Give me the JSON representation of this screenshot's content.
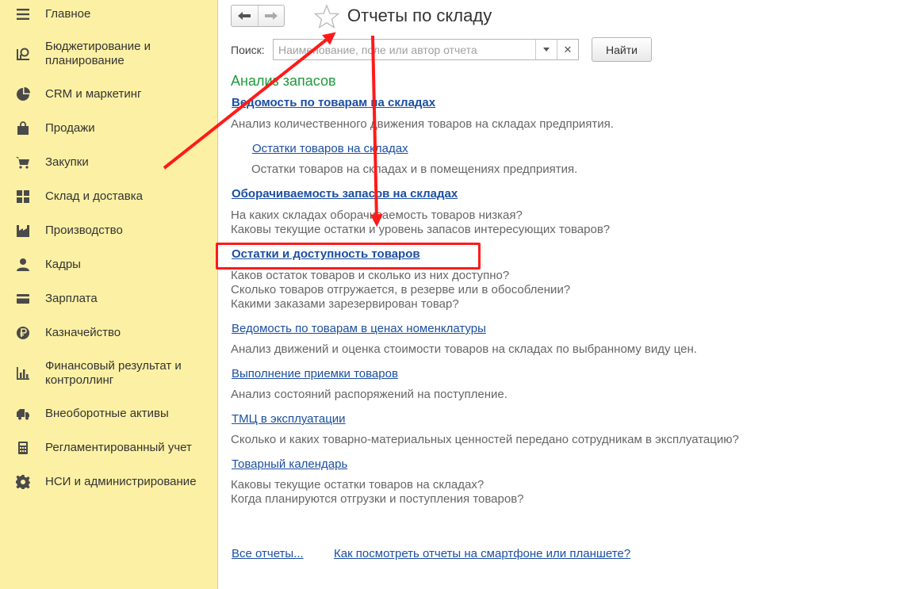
{
  "sidebar": {
    "items": [
      {
        "label": "Главное",
        "icon": "menu-icon"
      },
      {
        "label": "Бюджетирование и\nпланирование",
        "icon": "budget-chart-icon"
      },
      {
        "label": "CRM и маркетинг",
        "icon": "pie-chart-icon"
      },
      {
        "label": "Продажи",
        "icon": "shopping-bag-icon"
      },
      {
        "label": "Закупки",
        "icon": "cart-icon"
      },
      {
        "label": "Склад и доставка",
        "icon": "warehouse-grid-icon"
      },
      {
        "label": "Производство",
        "icon": "factory-icon"
      },
      {
        "label": "Кадры",
        "icon": "person-icon"
      },
      {
        "label": "Зарплата",
        "icon": "card-icon"
      },
      {
        "label": "Казначейство",
        "icon": "ruble-coin-icon"
      },
      {
        "label": "Финансовый результат и\nконтроллинг",
        "icon": "bar-chart-icon"
      },
      {
        "label": "Внеоборотные активы",
        "icon": "truck-icon"
      },
      {
        "label": "Регламентированный учет",
        "icon": "calculator-icon"
      },
      {
        "label": "НСИ и администрирование",
        "icon": "gear-icon"
      }
    ]
  },
  "header": {
    "title": "Отчеты по складу",
    "back_icon": "arrow-left-icon",
    "forward_icon": "arrow-right-icon",
    "favorite_icon": "star-icon"
  },
  "search": {
    "label": "Поиск:",
    "placeholder": "Наименование, поле или автор отчета",
    "value": "",
    "find_button": "Найти"
  },
  "section": {
    "title": "Анализ запасов",
    "reports": [
      {
        "title": "Ведомость по товарам на складах",
        "bold": true,
        "description": [
          "Анализ количественного движения товаров на складах предприятия."
        ]
      },
      {
        "title": "Остатки товаров на складах",
        "bold": false,
        "description": [
          "Остатки товаров на складах и в помещениях предприятия."
        ]
      },
      {
        "title": "Оборачиваемость запасов на складах",
        "bold": true,
        "description": [
          "На каких складах оборачиваемость товаров низкая?",
          "Каковы текущие остатки и уровень запасов интересующих товаров?"
        ]
      },
      {
        "title": "Остатки и доступность товаров",
        "bold": true,
        "description": [
          "Каков остаток товаров и сколько из них доступно?",
          "Сколько товаров отгружается, в резерве или в обособлении?",
          "Какими заказами зарезервирован товар?"
        ]
      },
      {
        "title": "Ведомость по товарам в ценах номенклатуры",
        "bold": false,
        "description": [
          "Анализ движений и оценка стоимости товаров на складах по выбранному виду цен."
        ]
      },
      {
        "title": "Выполнение приемки товаров",
        "bold": false,
        "description": [
          "Анализ состояний распоряжений на поступление."
        ]
      },
      {
        "title": "ТМЦ в эксплуатации",
        "bold": false,
        "description": [
          "Сколько и каких товарно-материальных ценностей передано сотрудникам в эксплуатацию?"
        ]
      },
      {
        "title": "Товарный календарь",
        "bold": false,
        "description": [
          "Каковы текущие остатки товаров на складах?",
          "Когда планируются отгрузки и поступления товаров?"
        ]
      }
    ]
  },
  "footer": {
    "all_reports": "Все отчеты...",
    "mobile_help": "Как посмотреть отчеты на смартфоне или планшете?"
  },
  "colors": {
    "sidebar_bg": "#fcf0a4",
    "link": "#1c4fa1",
    "section_title": "#1f9a3d",
    "annotation_red": "#ff1a1a"
  }
}
